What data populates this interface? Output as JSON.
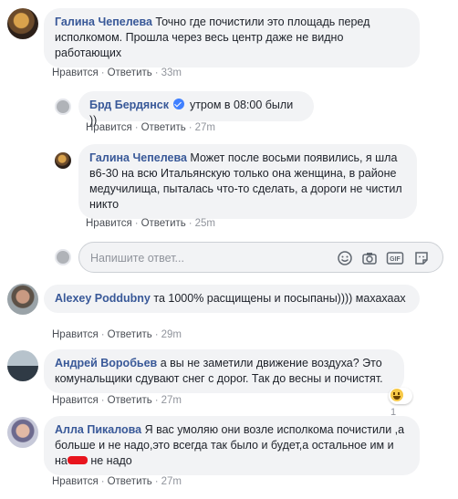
{
  "comments": [
    {
      "author": "Галина Чепелева",
      "text": "Точно где почистили это площадь перед исполкомом. Прошла через весь центр даже не видно работающих",
      "like": "Нравится",
      "reply": "Ответить",
      "time": "33m"
    },
    {
      "author": "Брд Бердянск",
      "text": "утром в 08:00 были ))",
      "like": "Нравится",
      "reply": "Ответить",
      "time": "27m"
    },
    {
      "author": "Галина Чепелева",
      "text": "Может после восьми появились, я шла в6-30 на всю Итальянскую только она женщина, в районе медучилища, пыталась что-то сделать, а дороги не чистил никто",
      "like": "Нравится",
      "reply": "Ответить",
      "time": "25m"
    },
    {
      "author": "Alexey Poddubny",
      "text": "та 1000% расщищены и посыпаны)))) махахаах",
      "like": "Нравится",
      "reply": "Ответить",
      "time": "29m"
    },
    {
      "author": "Андрей Воробьев",
      "text": "а вы не заметили движение воздуха? Это комунальщики сдувают снег с дорог. Так до весны и почистят.",
      "like": "Нравится",
      "reply": "Ответить",
      "time": "27m",
      "reaction_count": "1"
    },
    {
      "author": "Алла Пикалова",
      "text_part1": "Я вас умоляю они возле исполкома почистили ,а больше и не надо,это всегда так было и будет,а остальное им и на",
      "text_part2": " не надо",
      "like": "Нравится",
      "reply": "Ответить",
      "time": "27m"
    }
  ],
  "reply_box": {
    "placeholder": "Напишите ответ..."
  },
  "icons": {
    "emoji": "emoji-icon",
    "camera": "camera-icon",
    "gif": "gif-icon",
    "sticker": "sticker-icon",
    "verified": "verified-badge-icon",
    "reaction": "haha-reaction-icon"
  },
  "colors": {
    "author": "#385898",
    "bubble": "#f2f3f5",
    "meta": "#90949c",
    "verified": "#4080ff",
    "redaction": "#e8141d"
  }
}
